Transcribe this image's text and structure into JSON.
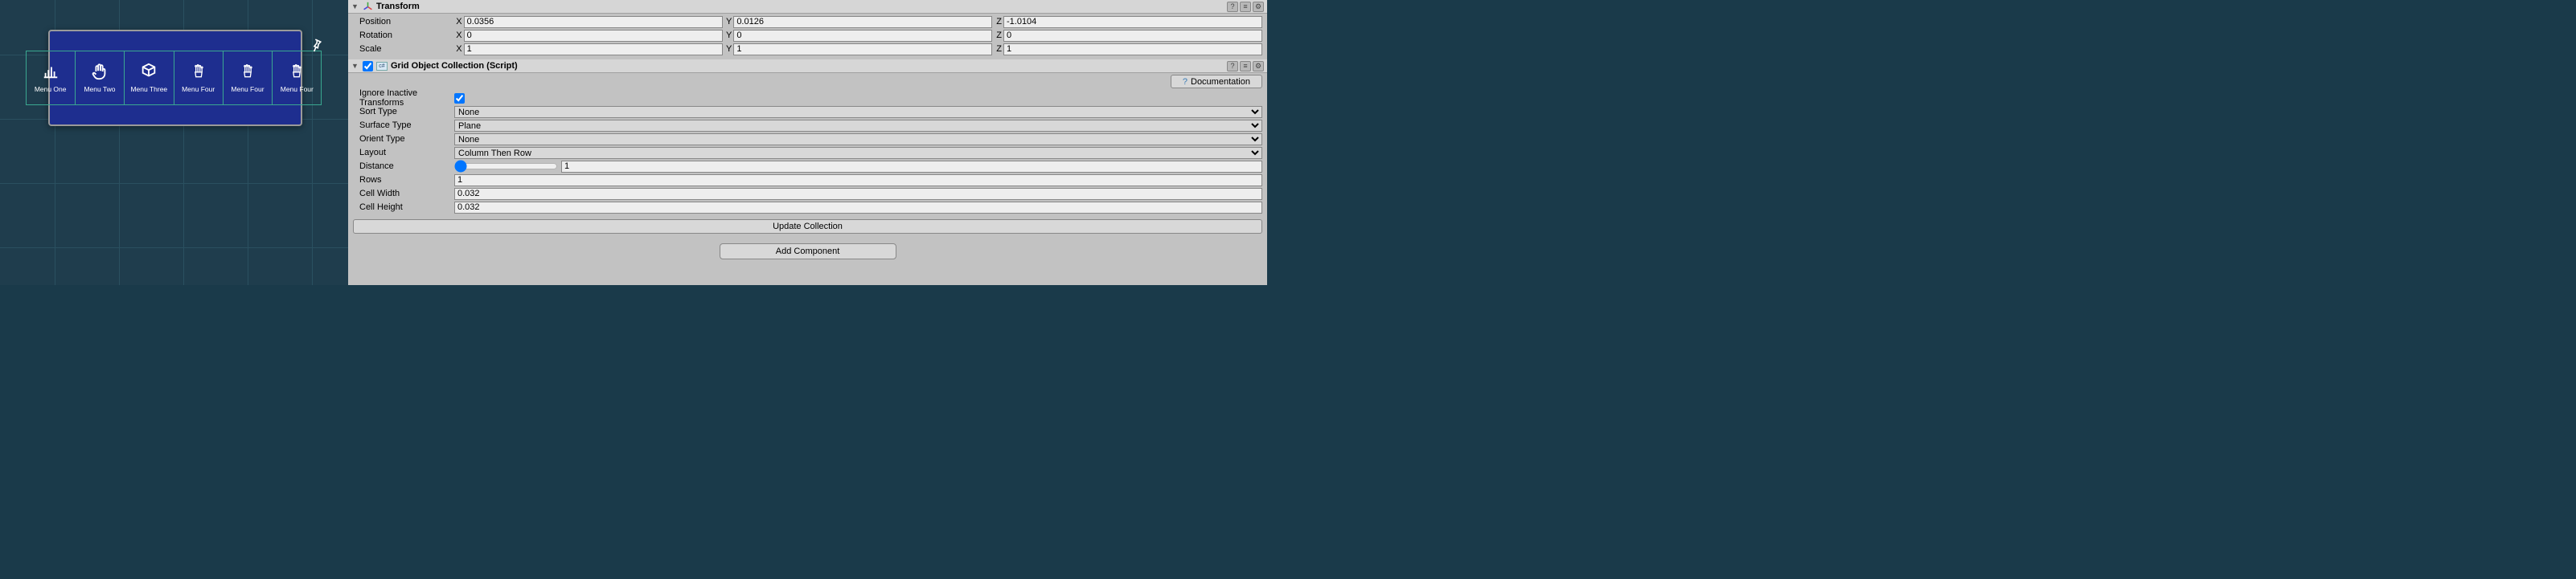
{
  "menu": {
    "items": [
      {
        "label": "Menu One"
      },
      {
        "label": "Menu Two"
      },
      {
        "label": "Menu Three"
      },
      {
        "label": "Menu Four"
      },
      {
        "label": "Menu Four"
      },
      {
        "label": "Menu Four"
      }
    ]
  },
  "transform": {
    "title": "Transform",
    "position": {
      "label": "Position",
      "x": "0.0356",
      "y": "0.0126",
      "z": "-1.0104"
    },
    "rotation": {
      "label": "Rotation",
      "x": "0",
      "y": "0",
      "z": "0"
    },
    "scale": {
      "label": "Scale",
      "x": "1",
      "y": "1",
      "z": "1"
    }
  },
  "grid": {
    "title": "Grid Object Collection (Script)",
    "documentation": "Documentation",
    "ignoreInactive": {
      "label": "Ignore Inactive Transforms",
      "checked": true
    },
    "sortType": {
      "label": "Sort Type",
      "value": "None"
    },
    "surfaceType": {
      "label": "Surface Type",
      "value": "Plane"
    },
    "orientType": {
      "label": "Orient Type",
      "value": "None"
    },
    "layout": {
      "label": "Layout",
      "value": "Column Then Row"
    },
    "distance": {
      "label": "Distance",
      "value": "1"
    },
    "rows": {
      "label": "Rows",
      "value": "1"
    },
    "cellWidth": {
      "label": "Cell Width",
      "value": "0.032"
    },
    "cellHeight": {
      "label": "Cell Height",
      "value": "0.032"
    },
    "updateBtn": "Update Collection"
  },
  "addComponent": "Add Component",
  "axes": {
    "x": "X",
    "y": "Y",
    "z": "Z"
  }
}
